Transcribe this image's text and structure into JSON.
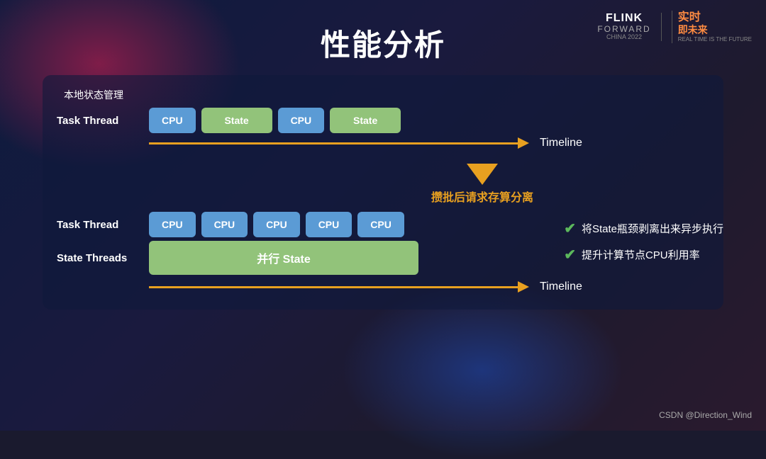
{
  "page": {
    "title": "性能分析",
    "background_label": "本地状态管理",
    "footer": "CSDN @Direction_Wind"
  },
  "logo": {
    "flink_line1": "FLINK",
    "flink_line2": "FORWARD",
    "flink_sub": "CHINA 2022",
    "realtime_line1": "实时",
    "realtime_line2": "即未来",
    "realtime_sub": "REAL TIME IS THE FUTURE"
  },
  "top_diagram": {
    "thread_label": "Task Thread",
    "blocks": [
      {
        "type": "cpu",
        "label": "CPU"
      },
      {
        "type": "state",
        "label": "State"
      },
      {
        "type": "cpu",
        "label": "CPU"
      },
      {
        "type": "state",
        "label": "State"
      }
    ],
    "timeline_label": "Timeline"
  },
  "middle": {
    "arrow_label": "攒批后请求存算分离"
  },
  "bottom_diagram": {
    "task_thread_label": "Task Thread",
    "task_blocks": [
      {
        "label": "CPU"
      },
      {
        "label": "CPU"
      },
      {
        "label": "CPU"
      },
      {
        "label": "CPU"
      },
      {
        "label": "CPU"
      }
    ],
    "state_threads_label": "State Threads",
    "state_block_label": "并行 State",
    "timeline_label": "Timeline"
  },
  "benefits": [
    {
      "text": "将State瓶颈剥离出来异步执行"
    },
    {
      "text": "提升计算节点CPU利用率"
    }
  ]
}
